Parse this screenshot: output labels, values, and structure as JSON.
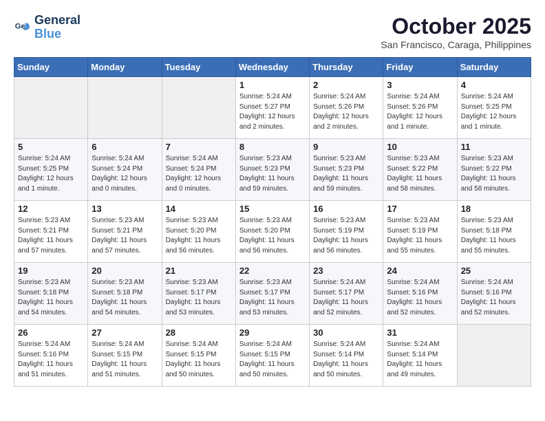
{
  "header": {
    "logo_line1": "General",
    "logo_line2": "Blue",
    "month": "October 2025",
    "location": "San Francisco, Caraga, Philippines"
  },
  "weekdays": [
    "Sunday",
    "Monday",
    "Tuesday",
    "Wednesday",
    "Thursday",
    "Friday",
    "Saturday"
  ],
  "weeks": [
    [
      {
        "day": "",
        "info": ""
      },
      {
        "day": "",
        "info": ""
      },
      {
        "day": "",
        "info": ""
      },
      {
        "day": "1",
        "info": "Sunrise: 5:24 AM\nSunset: 5:27 PM\nDaylight: 12 hours\nand 2 minutes."
      },
      {
        "day": "2",
        "info": "Sunrise: 5:24 AM\nSunset: 5:26 PM\nDaylight: 12 hours\nand 2 minutes."
      },
      {
        "day": "3",
        "info": "Sunrise: 5:24 AM\nSunset: 5:26 PM\nDaylight: 12 hours\nand 1 minute."
      },
      {
        "day": "4",
        "info": "Sunrise: 5:24 AM\nSunset: 5:25 PM\nDaylight: 12 hours\nand 1 minute."
      }
    ],
    [
      {
        "day": "5",
        "info": "Sunrise: 5:24 AM\nSunset: 5:25 PM\nDaylight: 12 hours\nand 1 minute."
      },
      {
        "day": "6",
        "info": "Sunrise: 5:24 AM\nSunset: 5:24 PM\nDaylight: 12 hours\nand 0 minutes."
      },
      {
        "day": "7",
        "info": "Sunrise: 5:24 AM\nSunset: 5:24 PM\nDaylight: 12 hours\nand 0 minutes."
      },
      {
        "day": "8",
        "info": "Sunrise: 5:23 AM\nSunset: 5:23 PM\nDaylight: 11 hours\nand 59 minutes."
      },
      {
        "day": "9",
        "info": "Sunrise: 5:23 AM\nSunset: 5:23 PM\nDaylight: 11 hours\nand 59 minutes."
      },
      {
        "day": "10",
        "info": "Sunrise: 5:23 AM\nSunset: 5:22 PM\nDaylight: 11 hours\nand 58 minutes."
      },
      {
        "day": "11",
        "info": "Sunrise: 5:23 AM\nSunset: 5:22 PM\nDaylight: 11 hours\nand 58 minutes."
      }
    ],
    [
      {
        "day": "12",
        "info": "Sunrise: 5:23 AM\nSunset: 5:21 PM\nDaylight: 11 hours\nand 57 minutes."
      },
      {
        "day": "13",
        "info": "Sunrise: 5:23 AM\nSunset: 5:21 PM\nDaylight: 11 hours\nand 57 minutes."
      },
      {
        "day": "14",
        "info": "Sunrise: 5:23 AM\nSunset: 5:20 PM\nDaylight: 11 hours\nand 56 minutes."
      },
      {
        "day": "15",
        "info": "Sunrise: 5:23 AM\nSunset: 5:20 PM\nDaylight: 11 hours\nand 56 minutes."
      },
      {
        "day": "16",
        "info": "Sunrise: 5:23 AM\nSunset: 5:19 PM\nDaylight: 11 hours\nand 56 minutes."
      },
      {
        "day": "17",
        "info": "Sunrise: 5:23 AM\nSunset: 5:19 PM\nDaylight: 11 hours\nand 55 minutes."
      },
      {
        "day": "18",
        "info": "Sunrise: 5:23 AM\nSunset: 5:18 PM\nDaylight: 11 hours\nand 55 minutes."
      }
    ],
    [
      {
        "day": "19",
        "info": "Sunrise: 5:23 AM\nSunset: 5:18 PM\nDaylight: 11 hours\nand 54 minutes."
      },
      {
        "day": "20",
        "info": "Sunrise: 5:23 AM\nSunset: 5:18 PM\nDaylight: 11 hours\nand 54 minutes."
      },
      {
        "day": "21",
        "info": "Sunrise: 5:23 AM\nSunset: 5:17 PM\nDaylight: 11 hours\nand 53 minutes."
      },
      {
        "day": "22",
        "info": "Sunrise: 5:23 AM\nSunset: 5:17 PM\nDaylight: 11 hours\nand 53 minutes."
      },
      {
        "day": "23",
        "info": "Sunrise: 5:24 AM\nSunset: 5:17 PM\nDaylight: 11 hours\nand 52 minutes."
      },
      {
        "day": "24",
        "info": "Sunrise: 5:24 AM\nSunset: 5:16 PM\nDaylight: 11 hours\nand 52 minutes."
      },
      {
        "day": "25",
        "info": "Sunrise: 5:24 AM\nSunset: 5:16 PM\nDaylight: 11 hours\nand 52 minutes."
      }
    ],
    [
      {
        "day": "26",
        "info": "Sunrise: 5:24 AM\nSunset: 5:16 PM\nDaylight: 11 hours\nand 51 minutes."
      },
      {
        "day": "27",
        "info": "Sunrise: 5:24 AM\nSunset: 5:15 PM\nDaylight: 11 hours\nand 51 minutes."
      },
      {
        "day": "28",
        "info": "Sunrise: 5:24 AM\nSunset: 5:15 PM\nDaylight: 11 hours\nand 50 minutes."
      },
      {
        "day": "29",
        "info": "Sunrise: 5:24 AM\nSunset: 5:15 PM\nDaylight: 11 hours\nand 50 minutes."
      },
      {
        "day": "30",
        "info": "Sunrise: 5:24 AM\nSunset: 5:14 PM\nDaylight: 11 hours\nand 50 minutes."
      },
      {
        "day": "31",
        "info": "Sunrise: 5:24 AM\nSunset: 5:14 PM\nDaylight: 11 hours\nand 49 minutes."
      },
      {
        "day": "",
        "info": ""
      }
    ]
  ]
}
